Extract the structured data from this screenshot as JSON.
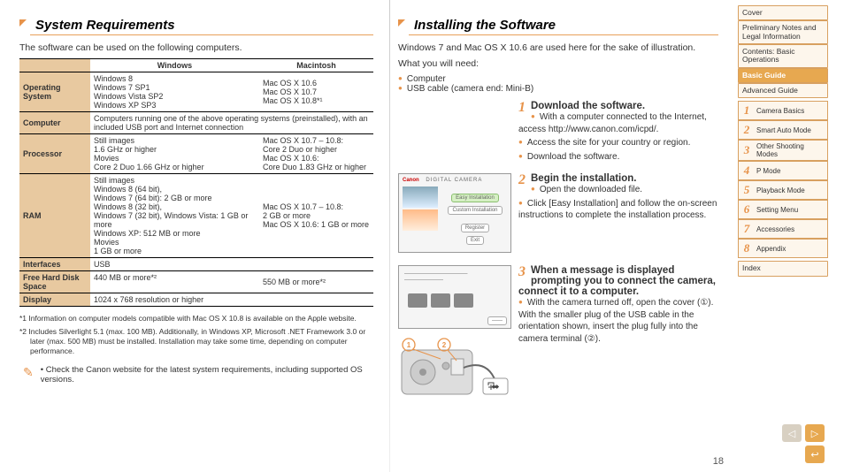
{
  "left": {
    "heading": "System Requirements",
    "intro": "The software can be used on the following computers.",
    "table": {
      "headers": [
        "",
        "Windows",
        "Macintosh"
      ],
      "rows": [
        {
          "label": "Operating System",
          "win": "Windows 8\nWindows 7 SP1\nWindows Vista SP2\nWindows XP SP3",
          "mac": "Mac OS X 10.6\nMac OS X 10.7\nMac OS X 10.8*¹"
        },
        {
          "label": "Computer",
          "span": "Computers running one of the above operating systems (preinstalled), with an included USB port and Internet connection"
        },
        {
          "label": "Processor",
          "win": "Still images\n1.6 GHz or higher\nMovies\nCore 2 Duo 1.66 GHz or higher",
          "mac": "Mac OS X 10.7 – 10.8:\nCore 2 Duo or higher\nMac OS X 10.6:\nCore Duo 1.83 GHz or higher"
        },
        {
          "label": "RAM",
          "win": "Still images\nWindows 8 (64 bit),\nWindows 7 (64 bit): 2 GB or more\nWindows 8 (32 bit),\nWindows 7 (32 bit), Windows Vista: 1 GB or more\nWindows XP: 512 MB or more\nMovies\n1 GB or more",
          "mac": "Mac OS X 10.7 – 10.8:\n2 GB or more\nMac OS X 10.6: 1 GB or more"
        },
        {
          "label": "Interfaces",
          "span": "USB"
        },
        {
          "label": "Free Hard Disk Space",
          "win": "440 MB or more*²",
          "mac": "550 MB or more*²"
        },
        {
          "label": "Display",
          "span": "1024 x 768 resolution or higher"
        }
      ]
    },
    "footnote1": "*1 Information on computer models compatible with Mac OS X 10.8 is available on the Apple website.",
    "footnote2": "*2 Includes Silverlight 5.1 (max. 100 MB). Additionally, in Windows XP, Microsoft .NET Framework 3.0 or later (max. 500 MB) must be installed. Installation may take some time, depending on computer performance.",
    "tip": "Check the Canon website for the latest system requirements, including supported OS versions."
  },
  "right": {
    "heading": "Installing the Software",
    "intro": "Windows 7 and Mac OS X 10.6 are used here for the sake of illustration.",
    "need_label": "What you will need:",
    "needs": [
      "Computer",
      "USB cable (camera end: Mini-B)"
    ],
    "steps": [
      {
        "n": "1",
        "title": "Download the software.",
        "items": [
          "With a computer connected to the Internet, access http://www.canon.com/icpd/.",
          "Access the site for your country or region.",
          "Download the software."
        ]
      },
      {
        "n": "2",
        "title": "Begin the installation.",
        "items": [
          "Open the downloaded file.",
          "Click [Easy Installation] and follow the on-screen instructions to complete the installation process."
        ]
      },
      {
        "n": "3",
        "title": "When a message is displayed prompting you to connect the camera, connect it to a computer.",
        "items": [
          "With the camera turned off, open the cover (①). With the smaller plug of the USB cable in the orientation shown, insert the plug fully into the camera terminal (②)."
        ]
      }
    ],
    "thumb1": {
      "brand": "Canon",
      "title": "DIGITAL CAMERA",
      "btn_easy": "Easy Installation",
      "btn_custom": "Custom Installation",
      "btn_reg": "Register",
      "btn_exit": "Exit"
    }
  },
  "nav": {
    "items": [
      {
        "label": "Cover"
      },
      {
        "label": "Preliminary Notes and Legal Information"
      },
      {
        "label": "Contents: Basic Operations"
      },
      {
        "label": "Basic Guide",
        "active": true
      },
      {
        "label": "Advanced Guide"
      }
    ],
    "subs": [
      {
        "n": "1",
        "label": "Camera Basics"
      },
      {
        "n": "2",
        "label": "Smart Auto Mode"
      },
      {
        "n": "3",
        "label": "Other Shooting Modes"
      },
      {
        "n": "4",
        "label": "P Mode"
      },
      {
        "n": "5",
        "label": "Playback Mode"
      },
      {
        "n": "6",
        "label": "Setting Menu"
      },
      {
        "n": "7",
        "label": "Accessories"
      },
      {
        "n": "8",
        "label": "Appendix"
      }
    ],
    "index": "Index"
  },
  "pagenum": "18"
}
